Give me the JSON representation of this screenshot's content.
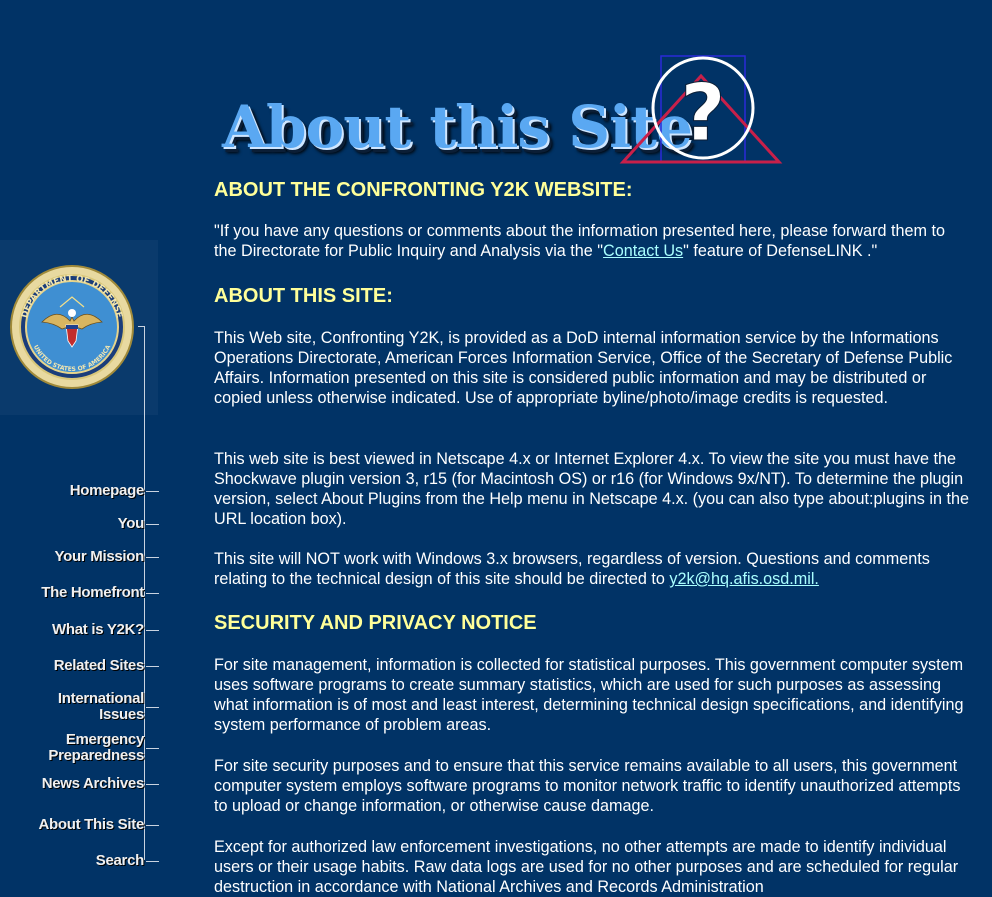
{
  "title_graphic": {
    "text": "About this Site",
    "mark": "?"
  },
  "sidebar": {
    "seal_alt": "Department of Defense seal",
    "seal_text_top": "DEPARTMENT OF DEFENSE",
    "seal_text_bottom": "UNITED STATES OF AMERICA",
    "items": [
      {
        "label": "Homepage"
      },
      {
        "label": "You"
      },
      {
        "label": "Your Mission"
      },
      {
        "label": "The Homefront"
      },
      {
        "label": "What is Y2K?"
      },
      {
        "label": "Related Sites"
      },
      {
        "label_line1": "International",
        "label_line2": "Issues"
      },
      {
        "label_line1": "Emergency",
        "label_line2": "Preparedness"
      },
      {
        "label": "News Archives"
      },
      {
        "label": "About This Site"
      },
      {
        "label": "Search"
      }
    ]
  },
  "sections": {
    "about_y2k": {
      "heading": "ABOUT THE CONFRONTING Y2K WEBSITE:",
      "text_before": "\"If you have any questions or comments about the information presented here, please forward them to the Directorate for Public Inquiry and Analysis via the \"",
      "link": "Contact Us",
      "text_after": "\" feature of DefenseLINK .\""
    },
    "about_site": {
      "heading": "ABOUT THIS SITE:",
      "p1": "This Web site, Confronting Y2K, is provided as a DoD internal information service by the Informations Operations Directorate, American Forces Information Service, Office of the Secretary of Defense Public Affairs. Information presented on this site is considered public information and may be distributed or copied unless otherwise indicated. Use of appropriate byline/photo/image credits is requested.",
      "p2": "This web site is best viewed in Netscape 4.x or Internet Explorer 4.x. To view the site you must have the Shockwave plugin version 3, r15 (for Macintosh OS) or r16 (for Windows 9x/NT). To determine the plugin version, select About Plugins from the Help menu in Netscape 4.x. (you can also type about:plugins in the URL location box).",
      "p3_before": "This site will NOT work with Windows 3.x browsers, regardless of version. Questions and comments relating to the technical design of this site should be directed to ",
      "p3_link": "y2k@hq.afis.osd.mil."
    },
    "security": {
      "heading": "SECURITY AND PRIVACY NOTICE",
      "p1": "For site management, information is collected for statistical purposes. This government computer system uses software programs to create summary statistics, which are used for such purposes as assessing what information is of most and least interest, determining technical design specifications, and identifying system performance of problem areas.",
      "p2": "For site security purposes and to ensure that this service remains available to all users, this government computer system employs software programs to monitor network traffic to identify unauthorized attempts to upload or change information, or otherwise cause damage.",
      "p3": "Except for authorized law enforcement investigations, no other attempts are made to identify individual users or their usage habits. Raw data logs are used for no other purposes and are scheduled for regular destruction in accordance with National Archives and Records Administration"
    }
  },
  "colors": {
    "background": "#013366",
    "heading": "#ffff99",
    "link": "#aaffff",
    "body_text": "#ffffff"
  }
}
